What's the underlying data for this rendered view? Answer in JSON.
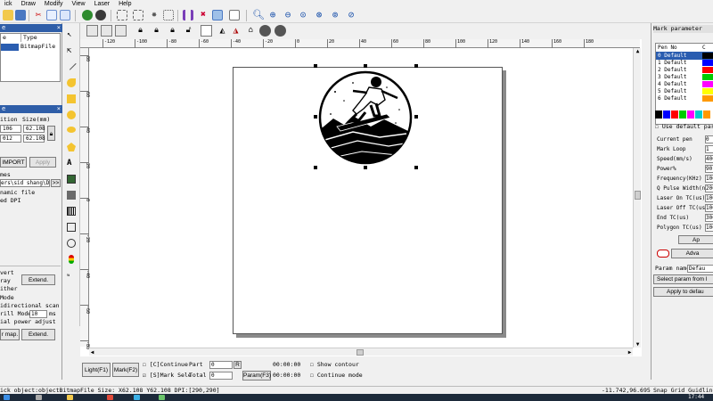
{
  "menubar": {
    "items": [
      "ick",
      "Draw",
      "Modify",
      "View",
      "Laser",
      "Help"
    ]
  },
  "left": {
    "object_list": {
      "col1": "e",
      "col2": "Type",
      "row_value": "BitmapFile"
    },
    "panel2_header": "e",
    "position": {
      "col_pos": "ition",
      "col_size": "Size(mm)",
      "row1_pos": "106",
      "row1_size": "62.108",
      "row2_pos": "012",
      "row2_size": "62.108"
    },
    "import_button": "IMPORT",
    "apply_button": "Apply",
    "bitmap": {
      "label_file": "mes",
      "path": "ers\\sid shang\\De",
      "browse": ">>",
      "dynamic_file": "namic file",
      "fixed_dpi": "ed DPI"
    },
    "image_opts": {
      "invert": "vert",
      "gray": "ray",
      "dither": "ither",
      "extend_button": "Extend.",
      "mode": "Mode",
      "bidirectional": "idirectional scan",
      "drill_mode_label": "rill Mode",
      "drill_mode_value": "10",
      "drill_mode_unit": "ms",
      "power_adjust": "ial power adjust",
      "map_button": "r map.",
      "extend_button2": "Extend."
    }
  },
  "right": {
    "header": "Mark parameter",
    "pen_col": "Pen No",
    "color_col": "C",
    "pens": [
      {
        "label": "0 Default",
        "color": "#000000"
      },
      {
        "label": "1 Default",
        "color": "#0000ff"
      },
      {
        "label": "2 Default",
        "color": "#ff0000"
      },
      {
        "label": "3 Default",
        "color": "#00cc00"
      },
      {
        "label": "4 Default",
        "color": "#ff00ff"
      },
      {
        "label": "5 Default",
        "color": "#ffff00"
      },
      {
        "label": "6 Default",
        "color": "#ff9900"
      }
    ],
    "palette": [
      "#000000",
      "#0000ff",
      "#ff0000",
      "#00cc00",
      "#ff00ff",
      "#00cccc",
      "#ff9900"
    ],
    "use_default": "Use default para",
    "fields": [
      {
        "label": "Current pen",
        "value": "0"
      },
      {
        "label": "Mark Loop",
        "value": "1"
      },
      {
        "label": "Speed(mm/s)",
        "value": "400"
      },
      {
        "label": "Power%",
        "value": "90"
      },
      {
        "label": "Frequency(KHz)",
        "value": "100"
      },
      {
        "label": "Q Pulse Width(n",
        "value": "200"
      },
      {
        "label": "Laser On TC(us)",
        "value": "100"
      },
      {
        "label": "Laser Off TC(us",
        "value": "100"
      },
      {
        "label": "End TC(us)",
        "value": "300"
      },
      {
        "label": "Polygon TC(us)",
        "value": "100"
      }
    ],
    "apply_button": "Ap",
    "advanced_button": "Adva",
    "param_name": "Param name",
    "param_name_value": "Defau",
    "select_param": "Select param from l",
    "apply_default": "Apply to defau"
  },
  "bottom": {
    "light_button": "Light(F1)",
    "mark_button": "Mark(F2)",
    "continue": "[C]Continue",
    "mark_sele": "[S]Mark Sele",
    "part_label": "Part",
    "part_value": "0",
    "total_label": "Total",
    "total_value": "0",
    "reset_button": "R",
    "time1": "00:00:00",
    "time2": "00:00:00",
    "param_button": "Param(F3)",
    "show_contour": "Show contour",
    "continue_mode": "Continue mode"
  },
  "statusbar": {
    "left": "ick object:objectBitmapFile Size: X62.108 Y62.108 DPI:[290,290]",
    "coords": "-11.742,96.695",
    "snap": "Snap Grid Guidline Ob"
  },
  "taskbar": {
    "clock": "17:44"
  },
  "rulers": {
    "h_ticks": [
      "-120",
      "-100",
      "-80",
      "-60",
      "-40",
      "-20",
      "0",
      "20",
      "40",
      "60",
      "80",
      "100",
      "120",
      "140",
      "160",
      "180"
    ],
    "v_ticks": [
      "80",
      "60",
      "40",
      "20",
      "0",
      "-20",
      "-40",
      "-60",
      "-80"
    ]
  }
}
